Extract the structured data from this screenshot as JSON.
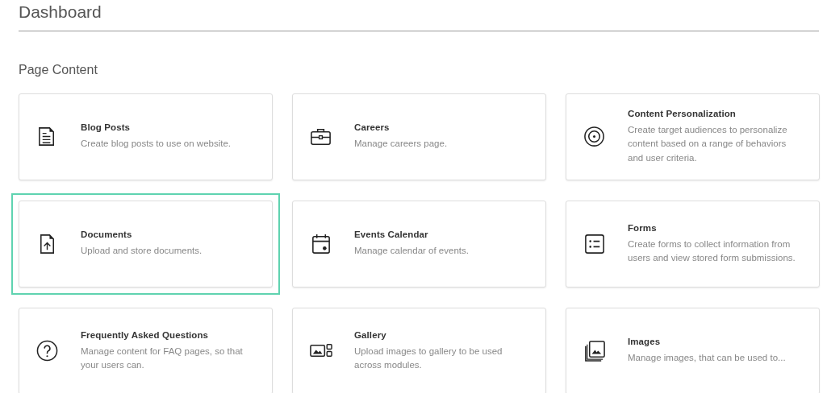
{
  "title": "Dashboard",
  "section": "Page Content",
  "cards": [
    {
      "title": "Blog Posts",
      "description": "Create blog posts to use on website.",
      "selected": false
    },
    {
      "title": "Careers",
      "description": "Manage careers page.",
      "selected": false
    },
    {
      "title": "Content Personalization",
      "description": "Create target audiences to personalize content based on a range of behaviors and user criteria.",
      "selected": false
    },
    {
      "title": "Documents",
      "description": "Upload and store documents.",
      "selected": true
    },
    {
      "title": "Events Calendar",
      "description": "Manage calendar of events.",
      "selected": false
    },
    {
      "title": "Forms",
      "description": "Create forms to collect information from users and view stored form submissions.",
      "selected": false
    },
    {
      "title": "Frequently Asked Questions",
      "description": "Manage content for FAQ pages, so that your users can.",
      "selected": false
    },
    {
      "title": "Gallery",
      "description": "Upload images to gallery to be used across modules.",
      "selected": false
    },
    {
      "title": "Images",
      "description": "Manage images, that can be used to...",
      "selected": false
    }
  ]
}
